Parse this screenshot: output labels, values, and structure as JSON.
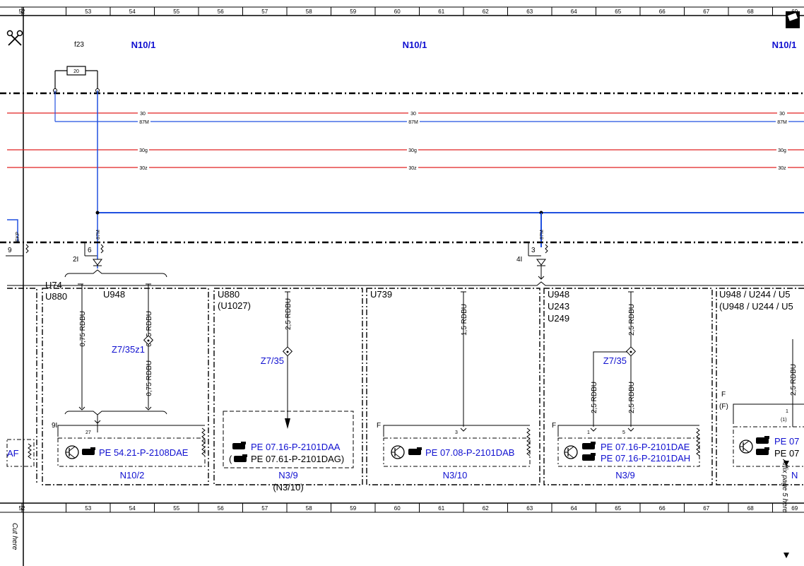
{
  "ruler": {
    "numbers": [
      "52",
      "53",
      "54",
      "55",
      "56",
      "57",
      "58",
      "59",
      "60",
      "61",
      "62",
      "63",
      "64",
      "65",
      "66",
      "67",
      "68",
      "69"
    ]
  },
  "header": {
    "fuse_label": "f23",
    "fuse_value": "20",
    "module_left": "N10/1",
    "module_mid": "N10/1",
    "module_right": "N10/1"
  },
  "bus": {
    "w30": "30",
    "w87m": "87M",
    "w30g": "30g",
    "w30z": "30z"
  },
  "left": {
    "ekp": "EKP",
    "pin9": "9",
    "pin21": "2I",
    "pin6": "6",
    "w87m_a": "87M",
    "pin41": "4I",
    "pin3": "3",
    "w87m_b": "87M",
    "af": "AF"
  },
  "box1": {
    "v1": "U74",
    "v2": "U880",
    "v3": "U948",
    "wire1": "0,75 RDBU",
    "wire2": "0,75 RDBU",
    "wire3": "0,75 RDBU",
    "conn": "Z7/35z1",
    "pin_grp": "9I",
    "pin27": "27",
    "ref": "PE 54.21-P-2108DAE",
    "module": "N10/2"
  },
  "box2": {
    "v1": "U880",
    "v2": "(U1027)",
    "wire1": "2,5 RDBU",
    "conn": "Z7/35",
    "ref1": "PE 07.16-P-2101DAA",
    "ref2_pre": "(",
    "ref2": "PE 07.61-P-2101DAG)",
    "module": "N3/9",
    "module2": "(N3/10)"
  },
  "box3": {
    "v1": "U739",
    "wire1": "1,5 RDBU",
    "f": "F",
    "pin3": "3",
    "ref": "PE 07.08-P-2101DAB",
    "module": "N3/10"
  },
  "box4": {
    "v1": "U948",
    "v2": "U243",
    "v3": "U249",
    "wire1": "2,5 RDBU",
    "conn": "Z7/35",
    "wire2": "2,5 RDBU",
    "wire3": "2,5 RDBU",
    "f": "F",
    "pin1": "1",
    "pin5": "5",
    "ref1": "PE 07.16-P-2101DAE",
    "ref2": "PE 07.16-P-2101DAH",
    "module": "N3/9"
  },
  "box5": {
    "v1": "U948 / U244 / U5",
    "v2": "(U948 / U244 / U5",
    "wire1": "2,5 RDBU",
    "f": "F",
    "f2": "(F)",
    "pin1": "1",
    "pin1b": "(1)",
    "ref1": "PE 07",
    "ref2": "PE 07",
    "module": "N"
  },
  "side": {
    "cut": "Cut here",
    "affix": "Affix page 5 here"
  }
}
